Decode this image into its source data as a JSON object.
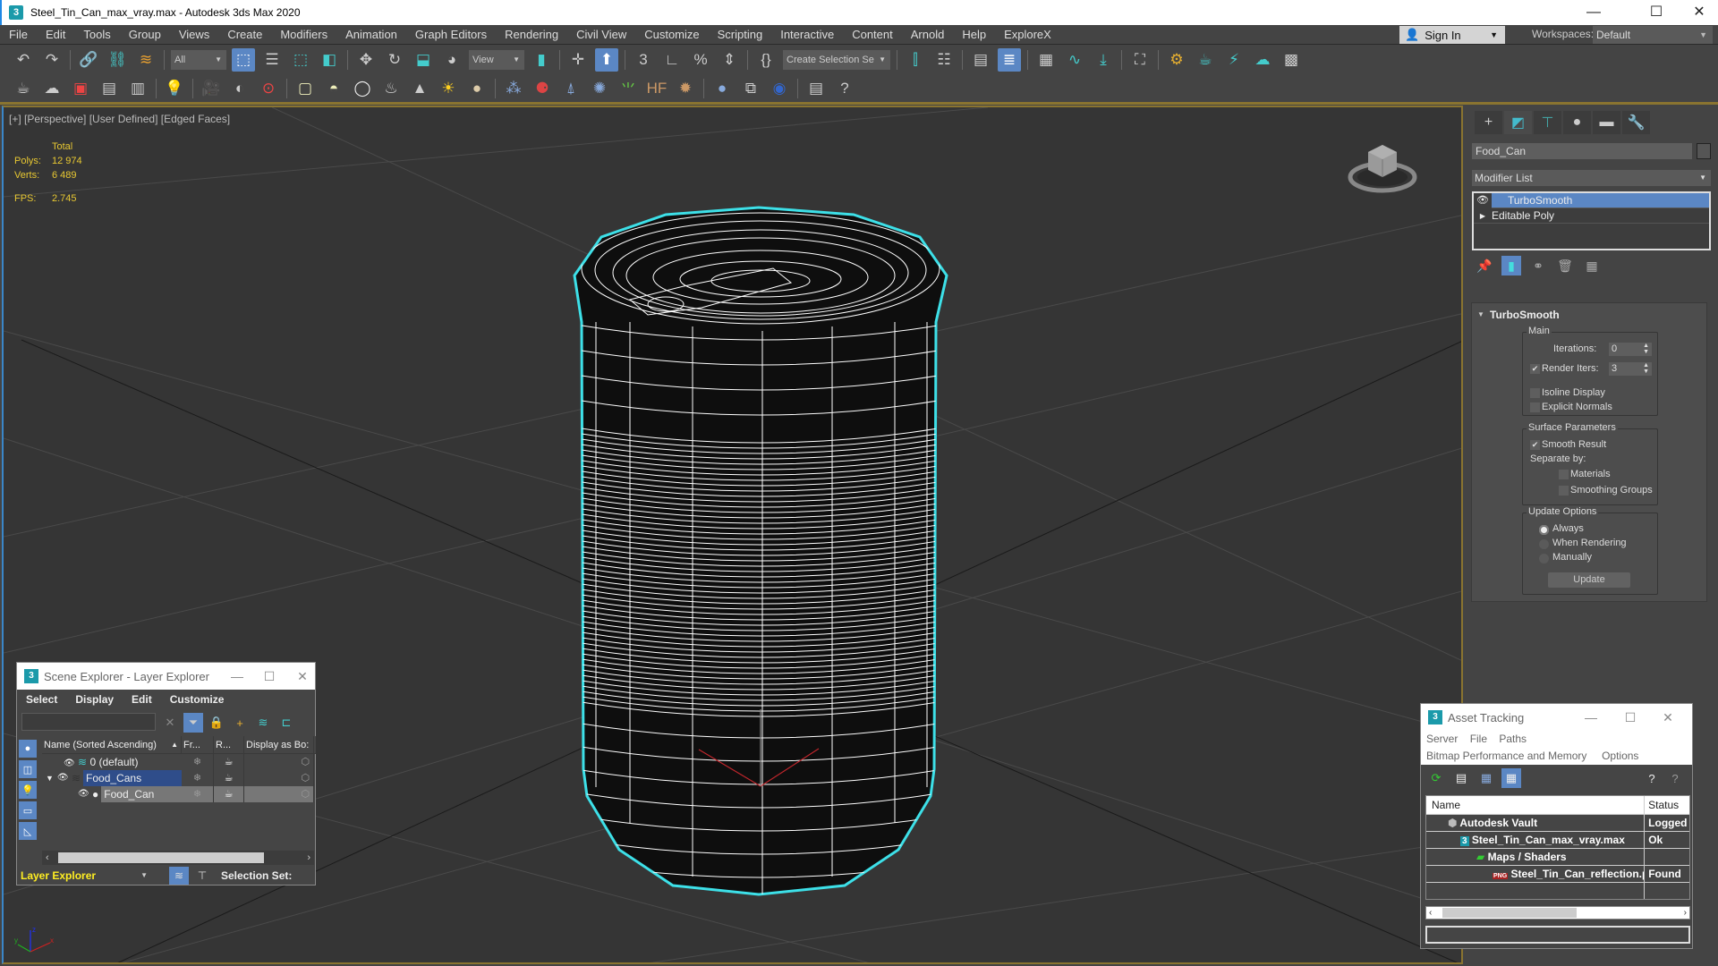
{
  "window": {
    "title": "Steel_Tin_Can_max_vray.max - Autodesk 3ds Max 2020",
    "app_icon": "3",
    "controls": {
      "minimize": "—",
      "maximize": "☐",
      "close": "✕"
    }
  },
  "menu": [
    "File",
    "Edit",
    "Tools",
    "Group",
    "Views",
    "Create",
    "Modifiers",
    "Animation",
    "Graph Editors",
    "Rendering",
    "Civil View",
    "Customize",
    "Scripting",
    "Interactive",
    "Content",
    "Arnold",
    "Help",
    "ExploreX"
  ],
  "account": {
    "signin_label": "Sign In",
    "workspaces_label": "Workspaces:",
    "workspace_value": "Default"
  },
  "toolbar_main": {
    "selection_filter": "All",
    "ref_coord": "View",
    "named_selection_placeholder": "Create Selection Se",
    "icons": [
      "undo-icon",
      "redo-icon",
      "link-icon",
      "unlink-icon",
      "bind-space-warp-icon",
      "select-object-icon",
      "select-by-name-icon",
      "rect-selection-icon",
      "window-crossing-icon",
      "move-icon",
      "rotate-icon",
      "scale-icon",
      "placement-icon",
      "pivot-icon",
      "select-manipulate-icon",
      "snaps-toggle-icon",
      "angle-snap-icon",
      "percent-snap-icon",
      "spinner-snap-icon",
      "edit-named-sel-icon",
      "mirror-icon",
      "align-icon",
      "scene-explorer-icon",
      "layer-explorer-icon",
      "ribbon-icon",
      "curve-editor-icon",
      "schematic-view-icon",
      "material-editor-icon",
      "render-setup-icon",
      "rendered-frame-icon",
      "render-icon",
      "render-cloud-icon",
      "a360-icon"
    ]
  },
  "viewport": {
    "label": "[+] [Perspective] [User Defined] [Edged Faces]",
    "stats": {
      "header": "Total",
      "polys_label": "Polys:",
      "polys": "12 974",
      "verts_label": "Verts:",
      "verts": "6 489",
      "fps_label": "FPS:",
      "fps": "2.745"
    },
    "axis_labels": {
      "x": "x",
      "y": "y",
      "z": "z"
    },
    "selection_color": "#3de0e8",
    "stats_color": "#e8c832"
  },
  "command_panel": {
    "tabs": [
      "create-tab",
      "modify-tab",
      "hierarchy-tab",
      "motion-tab",
      "display-tab",
      "utilities-tab"
    ],
    "object_name": "Food_Can",
    "modifier_list": "Modifier List",
    "stack": [
      {
        "name": "TurboSmooth",
        "selected": true
      },
      {
        "name": "Editable Poly",
        "selected": false
      }
    ],
    "rollout": {
      "title": "TurboSmooth",
      "main_group": "Main",
      "iterations_label": "Iterations:",
      "iterations": "0",
      "render_iters_label": "Render Iters:",
      "render_iters": "3",
      "render_iters_checked": true,
      "isoline_label": "Isoline Display",
      "isoline_checked": false,
      "explicit_normals_label": "Explicit Normals",
      "explicit_normals_checked": false,
      "surface_group": "Surface Parameters",
      "smooth_result_label": "Smooth Result",
      "smooth_result_checked": true,
      "separate_by_label": "Separate by:",
      "materials_label": "Materials",
      "materials_checked": false,
      "smoothing_groups_label": "Smoothing Groups",
      "smoothing_groups_checked": false,
      "update_group": "Update Options",
      "update_options": [
        "Always",
        "When Rendering",
        "Manually"
      ],
      "update_selected": "Always",
      "update_button": "Update"
    }
  },
  "scene_explorer": {
    "title": "Scene Explorer - Layer Explorer",
    "menu": [
      "Select",
      "Display",
      "Edit",
      "Customize"
    ],
    "columns": [
      "Name (Sorted Ascending)",
      "Fr...",
      "R...",
      "Display as Bo:"
    ],
    "rows": [
      {
        "name": "0 (default)",
        "level": 0,
        "type": "layer"
      },
      {
        "name": "Food_Cans",
        "level": 0,
        "type": "layer",
        "expanded": true,
        "selected": true
      },
      {
        "name": "Food_Can",
        "level": 1,
        "type": "object",
        "highlighted": true
      }
    ],
    "mode": "Layer Explorer",
    "selection_set_label": "Selection Set:"
  },
  "asset_tracking": {
    "title": "Asset Tracking",
    "menu_row1": [
      "Server",
      "File",
      "Paths"
    ],
    "menu_row2": [
      "Bitmap Performance and Memory",
      "Options"
    ],
    "columns": [
      "Name",
      "Status"
    ],
    "rows": [
      {
        "name": "Autodesk Vault",
        "status": "Logged (",
        "level": 0,
        "icon": "vault-icon"
      },
      {
        "name": "Steel_Tin_Can_max_vray.max",
        "status": "Ok",
        "level": 1,
        "icon": "max-file-icon"
      },
      {
        "name": "Maps / Shaders",
        "status": "",
        "level": 2,
        "icon": "maps-icon"
      },
      {
        "name": "Steel_Tin_Can_reflection.png",
        "status": "Found",
        "level": 3,
        "icon": "png-icon"
      }
    ]
  }
}
